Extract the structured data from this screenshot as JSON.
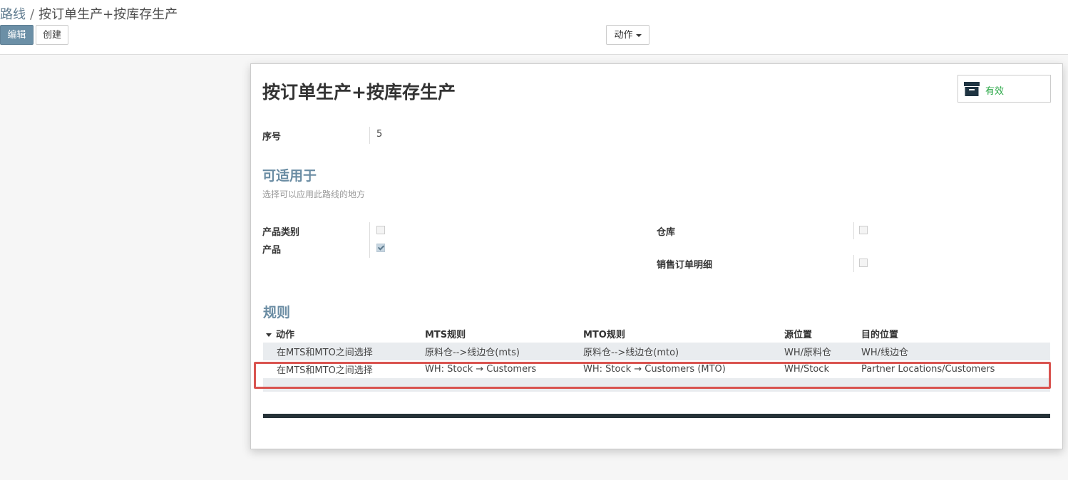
{
  "breadcrumb": {
    "parent": "路线",
    "separator": "/",
    "current": "按订单生产+按库存生产"
  },
  "toolbar": {
    "edit_label": "编辑",
    "create_label": "创建",
    "action_label": "动作"
  },
  "record": {
    "title": "按订单生产+按库存生产",
    "active_label": "有效",
    "sequence_label": "序号",
    "sequence_value": "5"
  },
  "applicable": {
    "title": "可适用于",
    "help": "选择可以应用此路线的地方",
    "product_category_label": "产品类别",
    "product_category_checked": false,
    "product_label": "产品",
    "product_checked": true,
    "warehouse_label": "仓库",
    "warehouse_checked": false,
    "sale_line_label": "销售订单明细",
    "sale_line_checked": false
  },
  "rules": {
    "title": "规则",
    "columns": [
      "动作",
      "MTS规则",
      "MTO规则",
      "源位置",
      "目的位置"
    ],
    "rows": [
      [
        "在MTS和MTO之间选择",
        "原料仓-->线边仓(mts)",
        "原料仓-->线边仓(mto)",
        "WH/原料仓",
        "WH/线边仓"
      ],
      [
        "在MTS和MTO之间选择",
        "WH: Stock → Customers",
        "WH: Stock → Customers (MTO)",
        "WH/Stock",
        "Partner Locations/Customers"
      ]
    ]
  },
  "colors": {
    "accent": "#6a8ca3",
    "edit_button": "#6b8fa6",
    "active": "#28a745",
    "highlight": "#d9534f"
  },
  "icons": {
    "active": "archive-icon",
    "dropdown": "caret-down-icon",
    "sort": "sort-caret-icon"
  }
}
